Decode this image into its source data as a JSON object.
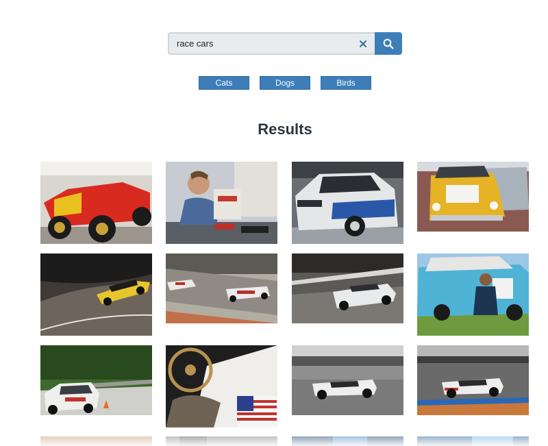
{
  "search": {
    "value": "race cars",
    "clear_icon": "close-icon",
    "submit_icon": "search-icon",
    "accent": "#3d7eb8"
  },
  "suggestions": [
    {
      "label": "Cats"
    },
    {
      "label": "Dogs"
    },
    {
      "label": "Birds"
    }
  ],
  "results_heading": "Results"
}
